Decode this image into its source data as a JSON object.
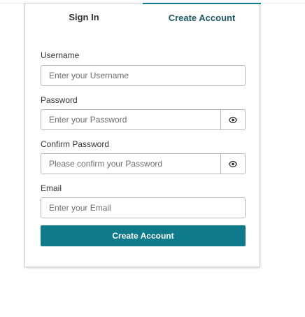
{
  "tabs": {
    "sign_in": "Sign In",
    "create_account": "Create Account",
    "active": "create_account"
  },
  "form": {
    "username": {
      "label": "Username",
      "placeholder": "Enter your Username",
      "value": ""
    },
    "password": {
      "label": "Password",
      "placeholder": "Enter your Password",
      "value": "",
      "toggle_icon": "eye-icon"
    },
    "confirm_password": {
      "label": "Confirm Password",
      "placeholder": "Please confirm your Password",
      "value": "",
      "toggle_icon": "eye-icon"
    },
    "email": {
      "label": "Email",
      "placeholder": "Enter your Email",
      "value": ""
    },
    "submit_label": "Create Account"
  },
  "colors": {
    "accent": "#0e7a8a",
    "active_tab_text": "#1d5a67",
    "input_border": "#b9b9b9"
  }
}
